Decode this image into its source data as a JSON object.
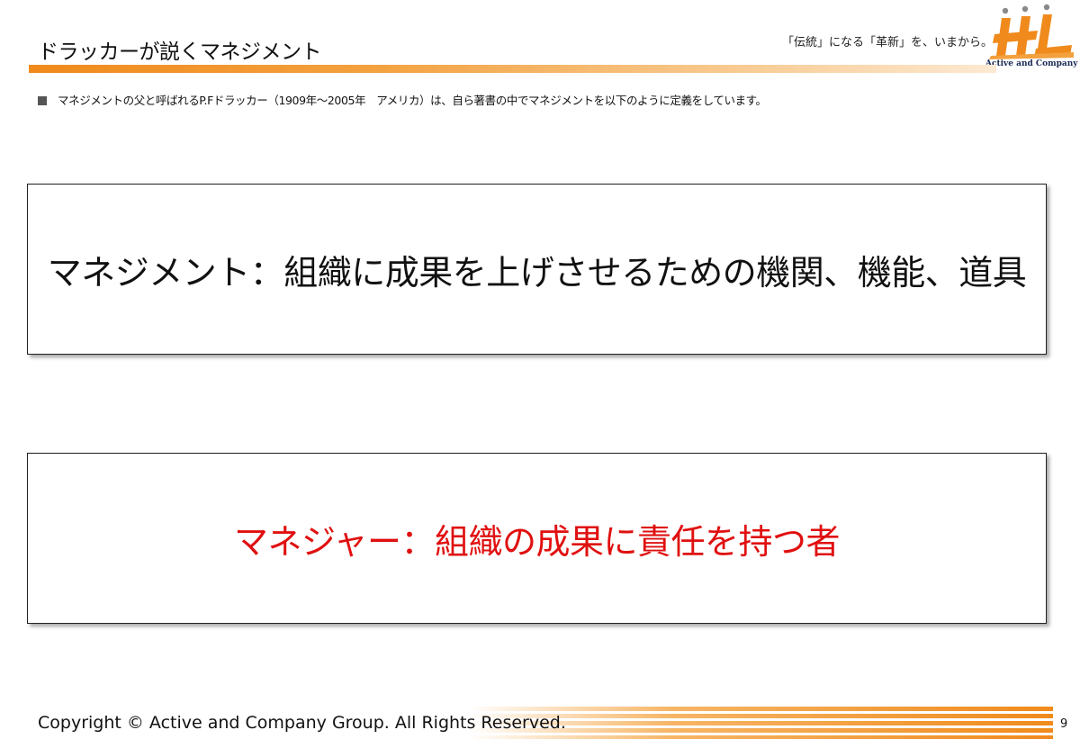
{
  "header": {
    "title": "ドラッカーが説くマネジメント",
    "tagline": "「伝統」になる「革新」を、いまから。",
    "logo_text": "Active and Company"
  },
  "intro": {
    "text": "マネジメントの父と呼ばれるP.Fドラッカー（1909年～2005年　アメリカ）は、自ら著書の中でマネジメントを以下のように定義をしています。"
  },
  "definitions": {
    "management": "マネジメント：組織に成果を上げさせるための機関、機能、道具",
    "manager": "マネジャー：組織の成果に責任を持つ者"
  },
  "footer": {
    "copyright": "Copyright © Active and Company Group. All Rights Reserved.",
    "page_number": "9"
  },
  "colors": {
    "accent_orange": "#f08a1c",
    "manager_red": "#e01010",
    "logo_navy": "#1a2a55"
  }
}
